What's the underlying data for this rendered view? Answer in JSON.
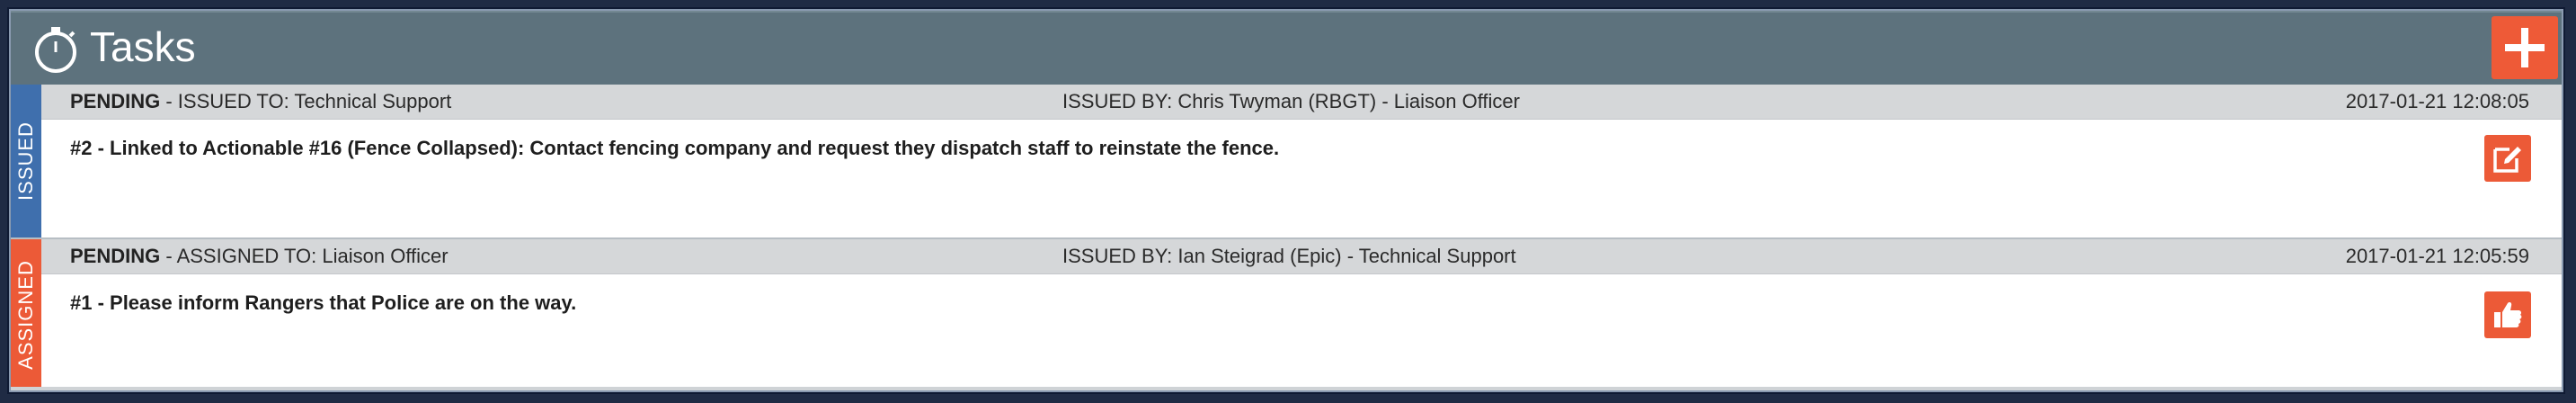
{
  "header": {
    "title": "Tasks",
    "add_icon": "plus-icon",
    "timer_icon": "stopwatch-icon"
  },
  "colors": {
    "titlebar": "#5d727d",
    "issued_tab": "#3f6fad",
    "assigned_tab": "#ec5a37",
    "action": "#ec5a37"
  },
  "tasks": [
    {
      "tab_label": "ISSUED",
      "status": "PENDING",
      "target": " - ISSUED TO: Technical Support",
      "issued_by": "ISSUED BY: Chris Twyman (RBGT) - Liaison Officer",
      "timestamp": "2017-01-21 12:08:05",
      "description": "#2 - Linked to Actionable #16 (Fence Collapsed): Contact fencing company and request they dispatch staff to reinstate the fence.",
      "action_icon": "edit-icon"
    },
    {
      "tab_label": "ASSIGNED",
      "status": "PENDING",
      "target": " - ASSIGNED TO: Liaison Officer",
      "issued_by": "ISSUED BY: Ian Steigrad (Epic) - Technical Support",
      "timestamp": "2017-01-21 12:05:59",
      "description": "#1 - Please inform Rangers that Police are on the way.",
      "action_icon": "thumbs-up-icon"
    }
  ]
}
